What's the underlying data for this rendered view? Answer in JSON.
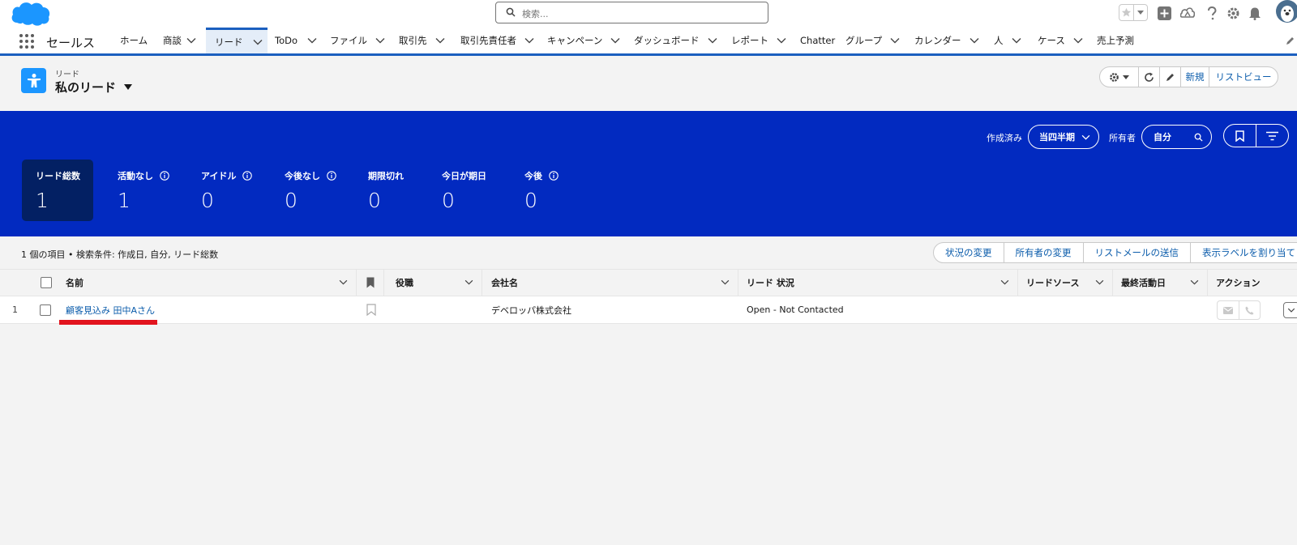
{
  "header": {
    "search_placeholder": "検索..."
  },
  "nav": {
    "app_name": "セールス",
    "items": [
      {
        "label": "ホーム"
      },
      {
        "label": "商談"
      },
      {
        "label": "リード"
      },
      {
        "label": "ToDo"
      },
      {
        "label": "ファイル"
      },
      {
        "label": "取引先"
      },
      {
        "label": "取引先責任者"
      },
      {
        "label": "キャンペーン"
      },
      {
        "label": "ダッシュボード"
      },
      {
        "label": "レポート"
      },
      {
        "label": "Chatter"
      },
      {
        "label": "グループ"
      },
      {
        "label": "カレンダー"
      },
      {
        "label": "人"
      },
      {
        "label": "ケース"
      },
      {
        "label": "売上予測"
      }
    ],
    "active": "リード"
  },
  "page_header": {
    "object_label": "リード",
    "list_title": "私のリード",
    "actions": {
      "new_label": "新規",
      "list_view_label": "リストビュー"
    }
  },
  "kpi_panel": {
    "created_label": "作成済み",
    "period_value": "当四半期",
    "owner_label": "所有者",
    "owner_value": "自分",
    "tiles": [
      {
        "label": "リード総数",
        "value": "1",
        "info": false,
        "selected": true
      },
      {
        "label": "活動なし",
        "value": "1",
        "info": true
      },
      {
        "label": "アイドル",
        "value": "0",
        "info": true
      },
      {
        "label": "今後なし",
        "value": "0",
        "info": true
      },
      {
        "label": "期限切れ",
        "value": "0",
        "info": false
      },
      {
        "label": "今日が期日",
        "value": "0",
        "info": false
      },
      {
        "label": "今後",
        "value": "0",
        "info": true
      }
    ]
  },
  "list": {
    "info": "1 個の項目 • 検索条件: 作成日, 自分, リード総数",
    "mass_actions": [
      "状況の変更",
      "所有者の変更",
      "リストメールの送信",
      "表示ラベルを割り当て"
    ],
    "columns": {
      "name": "名前",
      "title": "役職",
      "company": "会社名",
      "status": "リード 状況",
      "source": "リードソース",
      "last_activity": "最終活動日",
      "action": "アクション"
    },
    "rows": [
      {
        "num": "1",
        "name": "顧客見込み 田中Aさん",
        "title": "",
        "company": "デベロッパ株式会社",
        "status": "Open - Not Contacted",
        "source": "",
        "last_activity": ""
      }
    ]
  },
  "colors": {
    "brand_blue": "#022ac0",
    "link_blue": "#0b5cab",
    "highlight_red": "#e2141e",
    "logo_blue": "#1b96ff"
  }
}
